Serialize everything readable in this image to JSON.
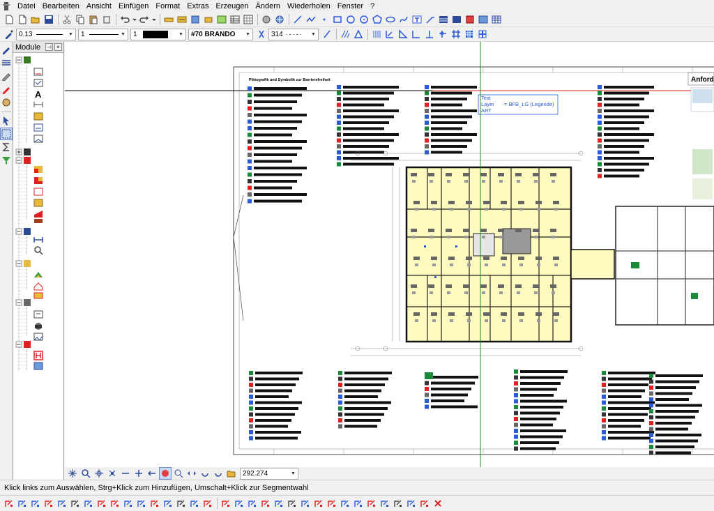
{
  "menubar": {
    "items": [
      "Datei",
      "Bearbeiten",
      "Ansicht",
      "Einfügen",
      "Format",
      "Extras",
      "Erzeugen",
      "Ändern",
      "Wiederholen",
      "Fenster",
      "?"
    ]
  },
  "toolbar2": {
    "line_width": "0.13",
    "color_index": "1",
    "layer": "#70 BRANDO",
    "line_type": "314"
  },
  "module_panel": {
    "title": "Module"
  },
  "zoombar": {
    "zoom_value": "292.274"
  },
  "statusbar": {
    "text": "Klick links zum Auswählen, Strg+Klick zum Hinzufügen, Umschalt+Klick zur Segmentwahl"
  },
  "drawing": {
    "tooltip_lines": [
      "Text",
      "Layer",
      "ART"
    ],
    "tooltip_value": "= BFB_LG (Legende)",
    "title_block_heading": "Anforder",
    "legend_heading": "Piktografik und Symbolik zur Barrierefreiheit"
  },
  "colors": {
    "accent_blue": "#2a5bd7",
    "crosshair_green": "#2db32d",
    "room_fill": "#fffbc0",
    "marker_red": "#e02020",
    "exit_green": "#1a8a3a"
  }
}
